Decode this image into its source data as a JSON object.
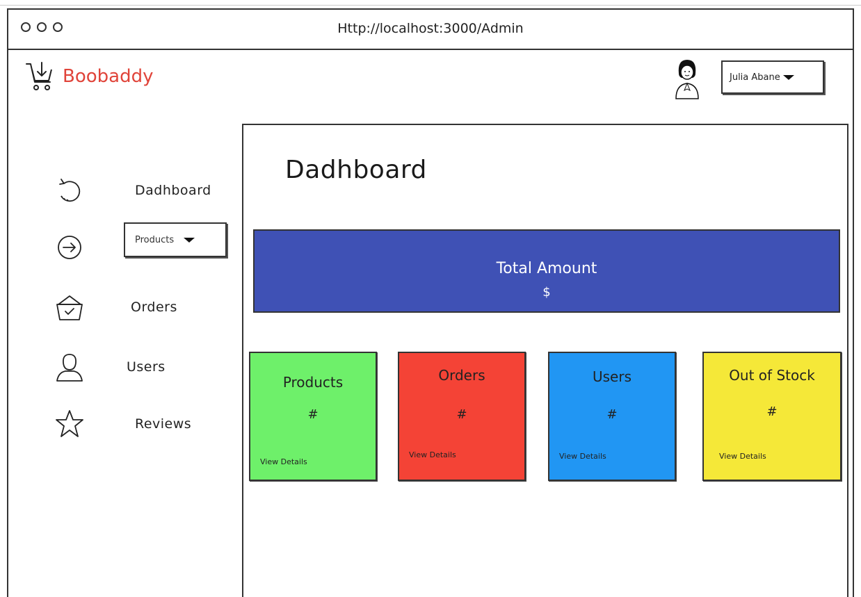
{
  "browser": {
    "url": "Http://localhost:3000/Admin"
  },
  "header": {
    "brand": "Boobaddy",
    "user_name": "Julia Abane"
  },
  "sidebar": {
    "items": [
      {
        "label": "Dadhboard",
        "icon": "refresh-icon"
      },
      {
        "label": "Products",
        "icon": "arrow-circle-icon"
      },
      {
        "label": "Orders",
        "icon": "basket-icon"
      },
      {
        "label": "Users",
        "icon": "user-icon"
      },
      {
        "label": "Reviews",
        "icon": "star-icon"
      }
    ]
  },
  "main": {
    "title": "Dadhboard",
    "total": {
      "title": "Total Amount",
      "value": "$"
    },
    "cards": [
      {
        "title": "Products",
        "value": "#",
        "link": "View Details",
        "color": "#6ef06a"
      },
      {
        "title": "Orders",
        "value": "#",
        "link": "View Details",
        "color": "#f44336"
      },
      {
        "title": "Users",
        "value": "#",
        "link": "View Details",
        "color": "#2196f3"
      },
      {
        "title": "Out of Stock",
        "value": "#",
        "link": "View Details",
        "color": "#f5e838"
      }
    ]
  },
  "colors": {
    "brand": "#e0443a",
    "banner": "#3f51b5"
  }
}
